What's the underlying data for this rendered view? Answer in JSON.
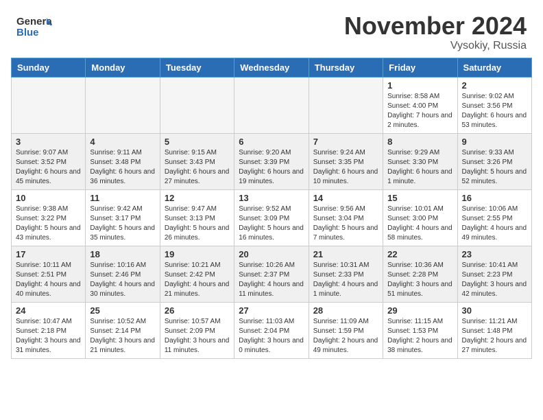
{
  "logo": {
    "line1": "General",
    "line2": "Blue"
  },
  "title": "November 2024",
  "location": "Vysokiy, Russia",
  "days_of_week": [
    "Sunday",
    "Monday",
    "Tuesday",
    "Wednesday",
    "Thursday",
    "Friday",
    "Saturday"
  ],
  "weeks": [
    [
      {
        "day": "",
        "info": ""
      },
      {
        "day": "",
        "info": ""
      },
      {
        "day": "",
        "info": ""
      },
      {
        "day": "",
        "info": ""
      },
      {
        "day": "",
        "info": ""
      },
      {
        "day": "1",
        "info": "Sunrise: 8:58 AM\nSunset: 4:00 PM\nDaylight: 7 hours and 2 minutes."
      },
      {
        "day": "2",
        "info": "Sunrise: 9:02 AM\nSunset: 3:56 PM\nDaylight: 6 hours and 53 minutes."
      }
    ],
    [
      {
        "day": "3",
        "info": "Sunrise: 9:07 AM\nSunset: 3:52 PM\nDaylight: 6 hours and 45 minutes."
      },
      {
        "day": "4",
        "info": "Sunrise: 9:11 AM\nSunset: 3:48 PM\nDaylight: 6 hours and 36 minutes."
      },
      {
        "day": "5",
        "info": "Sunrise: 9:15 AM\nSunset: 3:43 PM\nDaylight: 6 hours and 27 minutes."
      },
      {
        "day": "6",
        "info": "Sunrise: 9:20 AM\nSunset: 3:39 PM\nDaylight: 6 hours and 19 minutes."
      },
      {
        "day": "7",
        "info": "Sunrise: 9:24 AM\nSunset: 3:35 PM\nDaylight: 6 hours and 10 minutes."
      },
      {
        "day": "8",
        "info": "Sunrise: 9:29 AM\nSunset: 3:30 PM\nDaylight: 6 hours and 1 minute."
      },
      {
        "day": "9",
        "info": "Sunrise: 9:33 AM\nSunset: 3:26 PM\nDaylight: 5 hours and 52 minutes."
      }
    ],
    [
      {
        "day": "10",
        "info": "Sunrise: 9:38 AM\nSunset: 3:22 PM\nDaylight: 5 hours and 43 minutes."
      },
      {
        "day": "11",
        "info": "Sunrise: 9:42 AM\nSunset: 3:17 PM\nDaylight: 5 hours and 35 minutes."
      },
      {
        "day": "12",
        "info": "Sunrise: 9:47 AM\nSunset: 3:13 PM\nDaylight: 5 hours and 26 minutes."
      },
      {
        "day": "13",
        "info": "Sunrise: 9:52 AM\nSunset: 3:09 PM\nDaylight: 5 hours and 16 minutes."
      },
      {
        "day": "14",
        "info": "Sunrise: 9:56 AM\nSunset: 3:04 PM\nDaylight: 5 hours and 7 minutes."
      },
      {
        "day": "15",
        "info": "Sunrise: 10:01 AM\nSunset: 3:00 PM\nDaylight: 4 hours and 58 minutes."
      },
      {
        "day": "16",
        "info": "Sunrise: 10:06 AM\nSunset: 2:55 PM\nDaylight: 4 hours and 49 minutes."
      }
    ],
    [
      {
        "day": "17",
        "info": "Sunrise: 10:11 AM\nSunset: 2:51 PM\nDaylight: 4 hours and 40 minutes."
      },
      {
        "day": "18",
        "info": "Sunrise: 10:16 AM\nSunset: 2:46 PM\nDaylight: 4 hours and 30 minutes."
      },
      {
        "day": "19",
        "info": "Sunrise: 10:21 AM\nSunset: 2:42 PM\nDaylight: 4 hours and 21 minutes."
      },
      {
        "day": "20",
        "info": "Sunrise: 10:26 AM\nSunset: 2:37 PM\nDaylight: 4 hours and 11 minutes."
      },
      {
        "day": "21",
        "info": "Sunrise: 10:31 AM\nSunset: 2:33 PM\nDaylight: 4 hours and 1 minute."
      },
      {
        "day": "22",
        "info": "Sunrise: 10:36 AM\nSunset: 2:28 PM\nDaylight: 3 hours and 51 minutes."
      },
      {
        "day": "23",
        "info": "Sunrise: 10:41 AM\nSunset: 2:23 PM\nDaylight: 3 hours and 42 minutes."
      }
    ],
    [
      {
        "day": "24",
        "info": "Sunrise: 10:47 AM\nSunset: 2:18 PM\nDaylight: 3 hours and 31 minutes."
      },
      {
        "day": "25",
        "info": "Sunrise: 10:52 AM\nSunset: 2:14 PM\nDaylight: 3 hours and 21 minutes."
      },
      {
        "day": "26",
        "info": "Sunrise: 10:57 AM\nSunset: 2:09 PM\nDaylight: 3 hours and 11 minutes."
      },
      {
        "day": "27",
        "info": "Sunrise: 11:03 AM\nSunset: 2:04 PM\nDaylight: 3 hours and 0 minutes."
      },
      {
        "day": "28",
        "info": "Sunrise: 11:09 AM\nSunset: 1:59 PM\nDaylight: 2 hours and 49 minutes."
      },
      {
        "day": "29",
        "info": "Sunrise: 11:15 AM\nSunset: 1:53 PM\nDaylight: 2 hours and 38 minutes."
      },
      {
        "day": "30",
        "info": "Sunrise: 11:21 AM\nSunset: 1:48 PM\nDaylight: 2 hours and 27 minutes."
      }
    ]
  ]
}
